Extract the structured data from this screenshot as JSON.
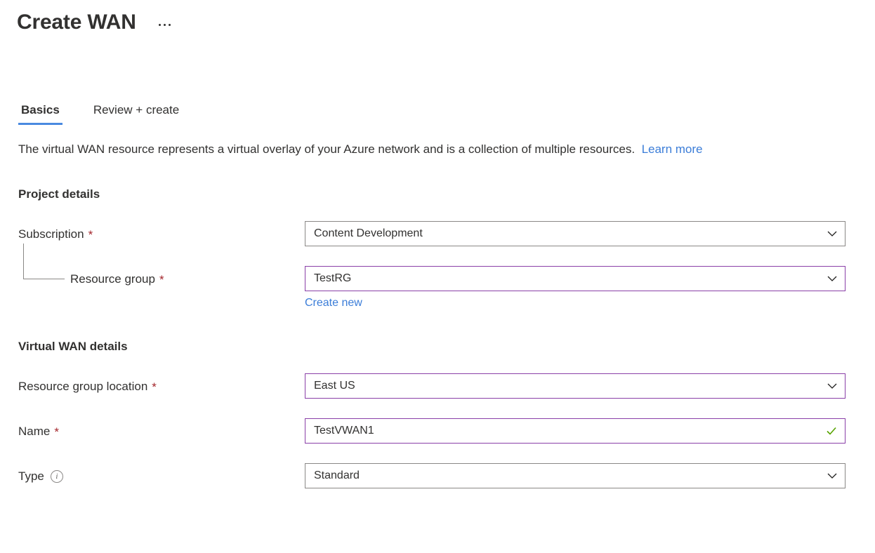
{
  "header": {
    "title": "Create WAN",
    "more_menu_label": "..."
  },
  "tabs": [
    {
      "label": "Basics",
      "active": true
    },
    {
      "label": "Review + create",
      "active": false
    }
  ],
  "description": {
    "text": "The virtual WAN resource represents a virtual overlay of your Azure network and is a collection of multiple resources.",
    "link_label": "Learn more"
  },
  "sections": {
    "project_details": {
      "heading": "Project details",
      "fields": {
        "subscription": {
          "label": "Subscription",
          "required": "*",
          "value": "Content Development",
          "icon": "chevron-down-icon"
        },
        "resource_group": {
          "label": "Resource group",
          "required": "*",
          "value": "TestRG",
          "icon": "chevron-down-icon",
          "create_new_label": "Create new"
        }
      }
    },
    "virtual_wan_details": {
      "heading": "Virtual WAN details",
      "fields": {
        "location": {
          "label": "Resource group location",
          "required": "*",
          "value": "East US",
          "icon": "chevron-down-icon"
        },
        "name": {
          "label": "Name",
          "required": "*",
          "value": "TestVWAN1",
          "icon": "check-icon"
        },
        "type": {
          "label": "Type",
          "info_icon": "info-icon",
          "value": "Standard",
          "icon": "chevron-down-icon"
        }
      }
    }
  },
  "colors": {
    "accent_blue": "#4a8ae0",
    "link_blue": "#3b7dd8",
    "required_red": "#a4262c",
    "focus_purple": "#8a3fa8",
    "valid_green": "#57a300",
    "border_gray": "#8a8886",
    "text": "#323130"
  }
}
